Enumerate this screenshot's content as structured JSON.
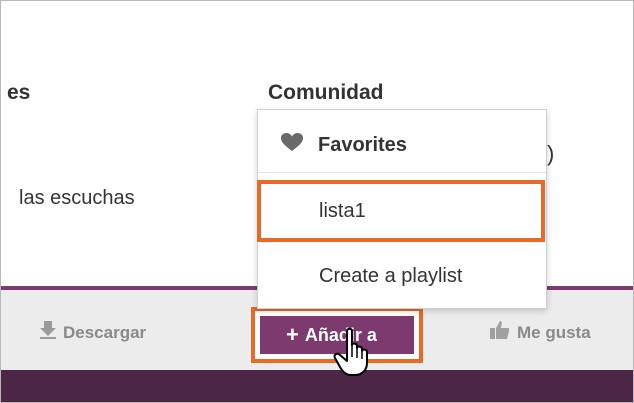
{
  "background": {
    "left_heading_partial": "es",
    "community_heading": "Comunidad",
    "listens_text": "las escuchas",
    "partial_digit": ")"
  },
  "toolbar": {
    "download_label": "Descargar",
    "add_to_label": "Añadir a",
    "like_label": "Me gusta"
  },
  "dropdown": {
    "items": [
      {
        "label": "Favorites",
        "icon": "heart-icon"
      },
      {
        "label": "lista1"
      },
      {
        "label": "Create a playlist"
      }
    ]
  },
  "colors": {
    "accent_purple": "#7c3a6f",
    "highlight_orange": "#e86a26",
    "dark_bar": "#4b2646"
  }
}
